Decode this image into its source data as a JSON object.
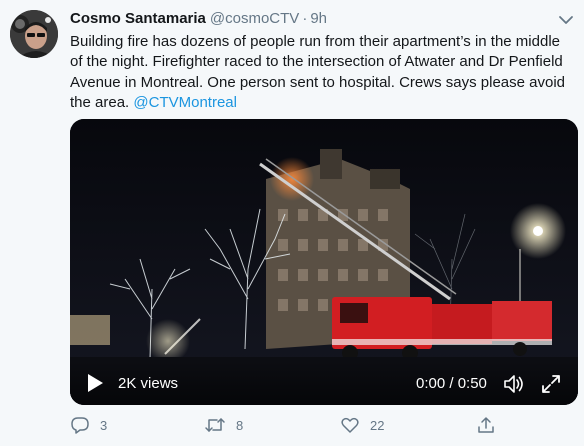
{
  "tweet": {
    "author_name": "Cosmo Santamaria",
    "author_handle": "@cosmoCTV",
    "separator": "·",
    "time": "9h",
    "text": "Building fire has dozens of people run from their apartment’s in the middle of the night. Firefighter raced to the intersection of Atwater and Dr Penfield Avenue in Montreal. One person sent to hospital. Crews says please avoid the area.",
    "mention": "@CTVMontreal"
  },
  "video": {
    "views": "2K views",
    "timecode": "0:00 / 0:50",
    "progress": 0
  },
  "actions": {
    "replies": "3",
    "retweets": "8",
    "likes": "22"
  },
  "icons": {
    "chevron": "chevron-down-icon",
    "play": "play-icon",
    "volume": "volume-icon",
    "fullscreen": "fullscreen-icon",
    "reply": "reply-icon",
    "retweet": "retweet-icon",
    "like": "heart-icon",
    "share": "share-icon"
  },
  "colors": {
    "background": "#f5f8fa",
    "text": "#14171a",
    "secondary": "#657786",
    "link": "#1b95e0"
  }
}
